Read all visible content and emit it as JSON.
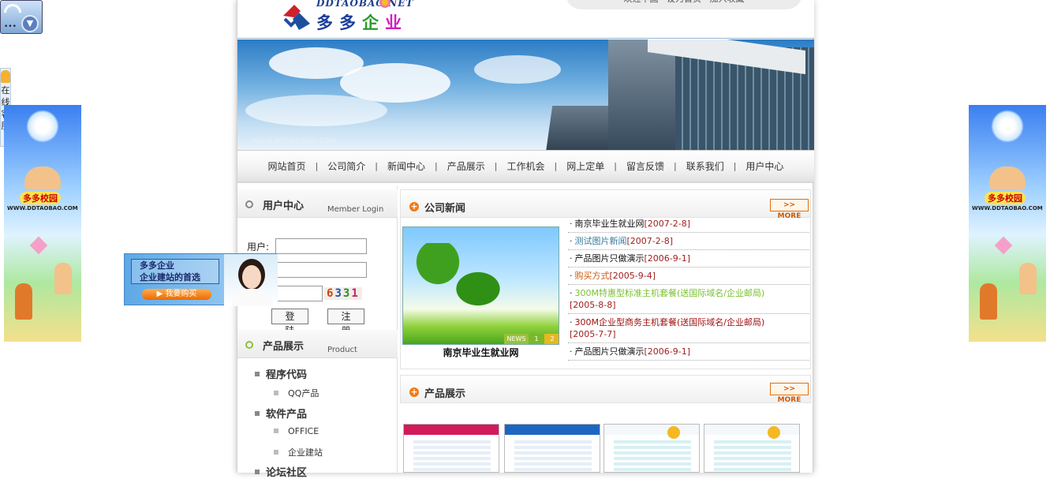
{
  "logo": {
    "en": "DDTAOBAO.NET",
    "cn": [
      "多",
      "多",
      "企",
      "业"
    ],
    "cn_colors": [
      "#1a3e9a",
      "#1a3e9a",
      "#2a9a2a",
      "#d020c0"
    ]
  },
  "header_pill": "欢迎中国 · 设为首页 · 加入收藏",
  "banner": {
    "url": "WWW.DDTAOBAO.COM"
  },
  "nav": {
    "items": [
      "网站首页",
      "公司简介",
      "新闻中心",
      "产品展示",
      "工作机会",
      "网上定单",
      "留言反馈",
      "联系我们",
      "用户中心"
    ],
    "separator": "|"
  },
  "user_center": {
    "title": "用户中心",
    "subtitle": "Member Login",
    "user_label": "用户:",
    "captcha": [
      "6",
      "3",
      "3",
      "1"
    ],
    "captcha_colors": [
      "#d04010",
      "#2050c0",
      "#209030",
      "#c02070"
    ],
    "login_label": "登 陆",
    "register_label": "注 册"
  },
  "product_menu": {
    "title": "产品展示",
    "subtitle": "Product",
    "categories": [
      {
        "label": "程序代码",
        "subs": [
          "QQ产品"
        ]
      },
      {
        "label": "软件产品",
        "subs": [
          "OFFICE",
          "企业建站"
        ]
      },
      {
        "label": "论坛社区",
        "subs": []
      }
    ]
  },
  "company_news": {
    "title": "公司新闻",
    "more": ">> MORE",
    "image_caption": "南京毕业生就业网",
    "image_tab": "NEWS",
    "image_pages": [
      "1",
      "2"
    ],
    "items": [
      {
        "title": "南京毕业生就业网",
        "date": "[2007-2-8]",
        "color": "#111"
      },
      {
        "title": "测试图片新闻",
        "date": "[2007-2-8]",
        "color": "#3a7a9a"
      },
      {
        "title": "产品图片只做演示",
        "date": "[2006-9-1]",
        "color": "#111"
      },
      {
        "title": "购买方式",
        "date": "[2005-9-4]",
        "color": "#d05a10"
      },
      {
        "title": "300M特惠型标准主机套餐(送国际域名/企业邮局)",
        "date": "[2005-8-8]",
        "color": "#7ac030"
      },
      {
        "title": "300M企业型商务主机套餐(送国际域名/企业邮局)",
        "date": "[2005-7-7]",
        "color": "#a01010"
      },
      {
        "title": "产品图片只做演示",
        "date": "[2006-9-1]",
        "color": "#111"
      }
    ]
  },
  "product_show": {
    "title": "产品展示",
    "more": ">> MORE"
  },
  "float_ad": {
    "line1": "多多企业",
    "line2": "企业建站的首选",
    "button": "我要购买"
  },
  "kefu": {
    "chars": [
      "在",
      "线",
      "客",
      "服"
    ]
  },
  "side_ad": {
    "title": "多多校园",
    "url": "WWW.DDTAOBAO.COM"
  },
  "colors": {
    "accent_orange": "#f07a12",
    "link_blue": "#1d3f8f",
    "date_red": "#a02020"
  }
}
